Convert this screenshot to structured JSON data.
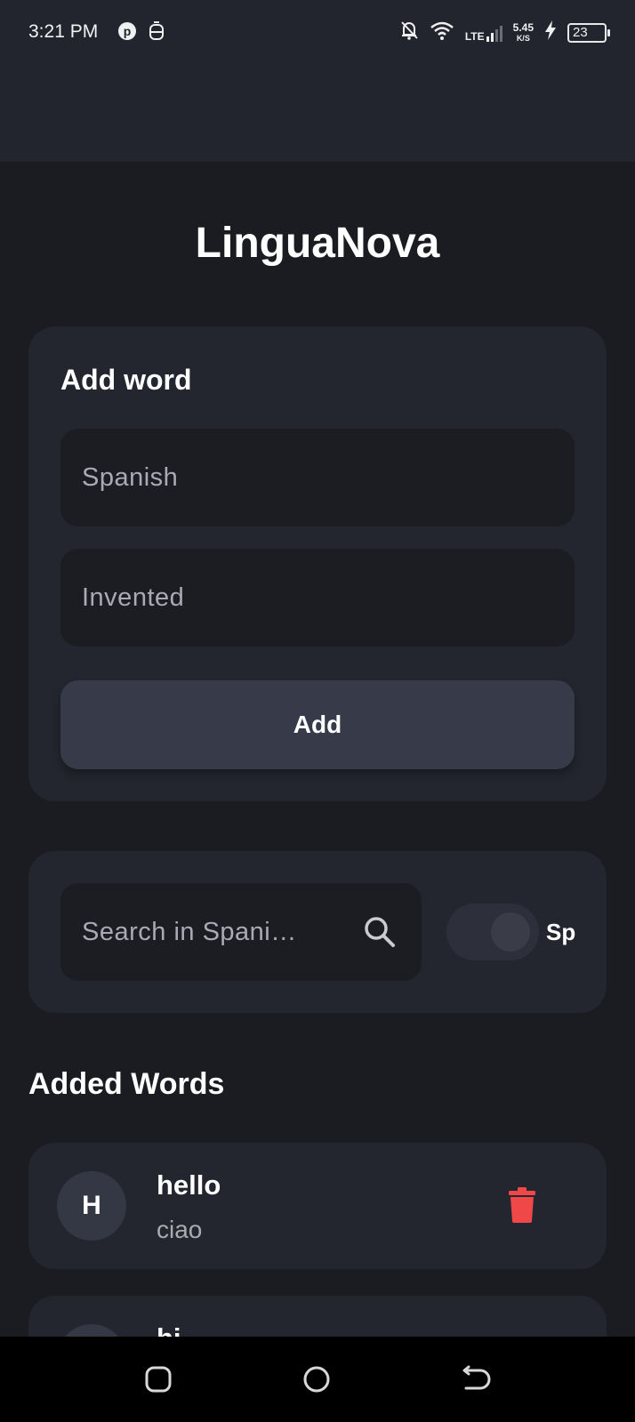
{
  "status_bar": {
    "time": "3:21 PM",
    "network_type": "LTE",
    "speed_value": "5.45",
    "speed_unit": "K/S",
    "battery": "23",
    "icons": [
      "pinterest-icon",
      "notification-icon",
      "bell-off-icon",
      "wifi-icon",
      "signal-icon",
      "charging-icon",
      "battery-icon"
    ]
  },
  "app": {
    "title": "LinguaNova"
  },
  "add_card": {
    "title": "Add word",
    "spanish_placeholder": "Spanish",
    "spanish_value": "",
    "invented_placeholder": "Invented",
    "invented_value": "",
    "add_label": "Add"
  },
  "search": {
    "placeholder": "Search in Spani…",
    "value": "",
    "toggle_label": "Sp",
    "toggle_on": false
  },
  "words_section": {
    "title": "Added Words",
    "items": [
      {
        "initial": "H",
        "word": "hello",
        "translation": "ciao"
      },
      {
        "initial": "",
        "word": "hi",
        "translation": ""
      }
    ]
  },
  "colors": {
    "background": "#1b1c21",
    "card": "#23262f",
    "input": "#1c1d22",
    "button": "#363a49",
    "delete": "#f04848"
  }
}
